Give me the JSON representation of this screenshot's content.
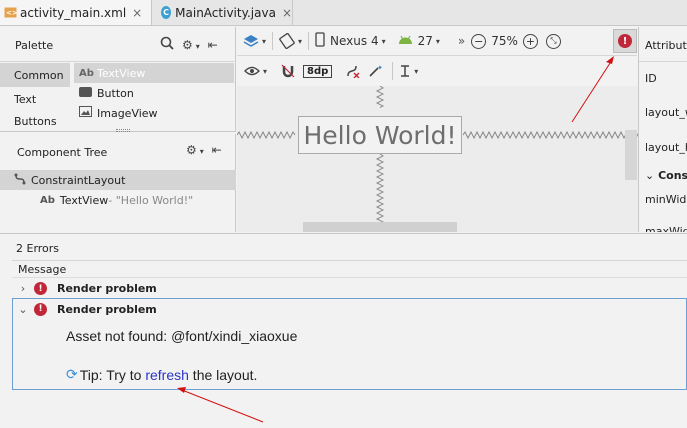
{
  "tabs": [
    {
      "label": "activity_main.xml"
    },
    {
      "label": "MainActivity.java"
    }
  ],
  "palette": {
    "title": "Palette",
    "categories": [
      "Common",
      "Text",
      "Buttons"
    ],
    "items": [
      {
        "icon": "Ab",
        "label": "TextView"
      },
      {
        "icon": "btn",
        "label": "Button"
      },
      {
        "icon": "img",
        "label": "ImageView"
      }
    ]
  },
  "component_tree": {
    "title": "Component Tree",
    "root": "ConstraintLayout",
    "child_icon": "Ab",
    "child": "TextView",
    "child_hint": "- \"Hello World!\""
  },
  "toolbar": {
    "device": "Nexus 4",
    "api": "27",
    "zoom": "75%",
    "margin": "8dp"
  },
  "canvas": {
    "hello_text": "Hello World!"
  },
  "attributes": {
    "title": "Attributes",
    "rows": [
      "ID",
      "layout_w",
      "layout_h",
      "Constr",
      "minWid",
      "maxWid"
    ]
  },
  "messages": {
    "count_label": "2 Errors",
    "column_header": "Message",
    "rows": [
      {
        "title": "Render problem"
      },
      {
        "title": "Render problem"
      }
    ],
    "detail_text": "Asset not found: @font/xindi_xiaoxue",
    "tip_prefix": "Tip: Try to ",
    "tip_link": "refresh",
    "tip_suffix": " the layout."
  },
  "colors": {
    "error": "#c0283a",
    "link": "#2a35c8",
    "selection_border": "#6d9fd4"
  }
}
